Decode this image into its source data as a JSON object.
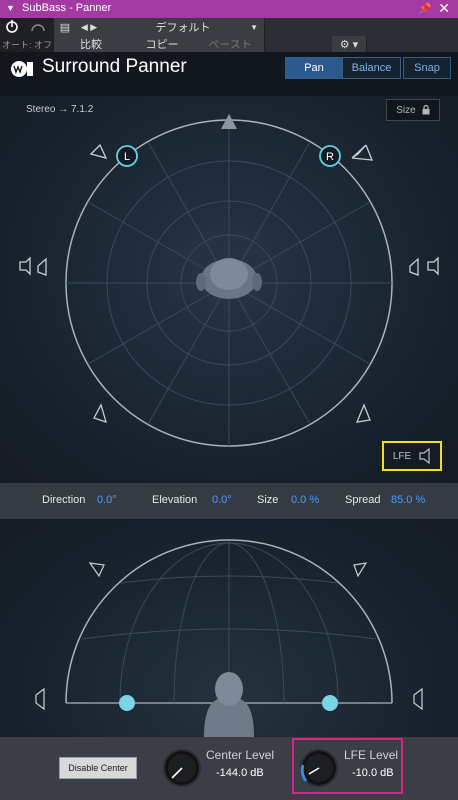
{
  "window": {
    "title": "SubBass - Panner"
  },
  "preset": {
    "name": "デフォルト",
    "automation": "オート: オフ",
    "compare": "比較",
    "copy": "コピー",
    "paste": "ペースト"
  },
  "app": {
    "title": "Surround Panner",
    "modes": [
      "Pan",
      "Balance",
      "Snap"
    ],
    "active_mode": "Pan"
  },
  "routing": "Stereo → 7.1.2",
  "size_button": "Size",
  "lfe_button": "LFE",
  "speakers": {
    "left": "L",
    "right": "R"
  },
  "params": {
    "direction": {
      "label": "Direction",
      "value": "0.0°"
    },
    "elevation": {
      "label": "Elevation",
      "value": "0.0°"
    },
    "size": {
      "label": "Size",
      "value": "0.0 %"
    },
    "spread": {
      "label": "Spread",
      "value": "85.0 %"
    }
  },
  "footer": {
    "disable_center": "Disable Center",
    "center_level": {
      "label": "Center Level",
      "value": "-144.0 dB"
    },
    "lfe_level": {
      "label": "LFE Level",
      "value": "-10.0 dB"
    }
  },
  "colors": {
    "accent": "#2c5a8f",
    "value_blue": "#4a9bff",
    "speaker_cyan": "#5fd3e6",
    "highlight_yellow": "#f2df1a",
    "highlight_magenta": "#d2268a",
    "titlebar": "#a23aa2"
  }
}
